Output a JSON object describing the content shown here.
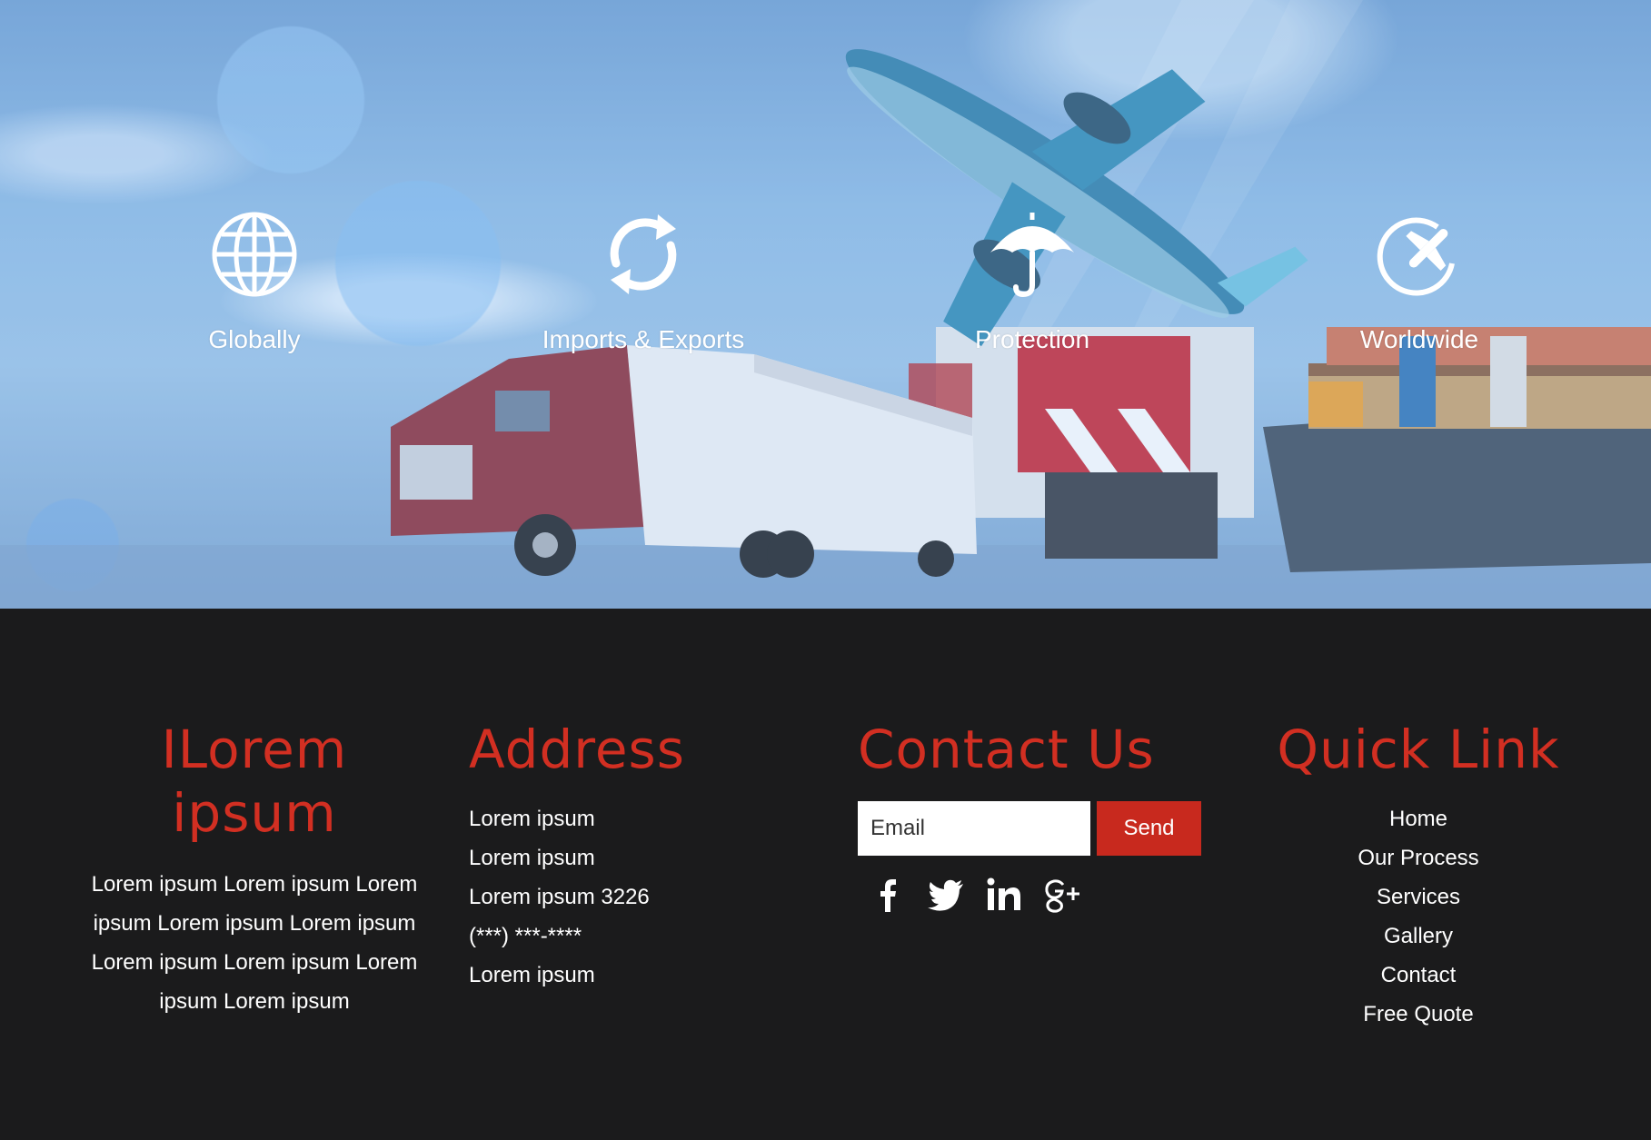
{
  "hero": {
    "features": [
      {
        "icon": "globe-icon",
        "label": "Globally"
      },
      {
        "icon": "refresh-arrows-icon",
        "label": "Imports & Exports"
      },
      {
        "icon": "umbrella-icon",
        "label": "Protection"
      },
      {
        "icon": "airplane-globe-icon",
        "label": "Worldwide"
      }
    ]
  },
  "footer": {
    "about": {
      "title": "ILorem ipsum",
      "text": "Lorem ipsum Lorem ipsum Lorem ipsum Lorem ipsum Lorem ipsum Lorem ipsum Lorem ipsum Lorem ipsum Lorem ipsum"
    },
    "address": {
      "title": "Address",
      "lines": [
        "Lorem ipsum",
        "Lorem ipsum",
        "Lorem ipsum 3226",
        "(***) ***-****",
        "Lorem ipsum"
      ]
    },
    "contact": {
      "title": "Contact Us",
      "email_placeholder": "Email",
      "send_label": "Send",
      "social": [
        "facebook-icon",
        "twitter-icon",
        "linkedin-icon",
        "google-plus-icon"
      ]
    },
    "quick_links": {
      "title": "Quick Link",
      "items": [
        "Home",
        "Our Process",
        "Services",
        "Gallery",
        "Contact",
        "Free Quote"
      ]
    }
  },
  "colors": {
    "accent": "#d22f22",
    "button": "#c8291e",
    "footer_bg": "#1b1b1c",
    "hero_sky": "#8ebce6"
  }
}
